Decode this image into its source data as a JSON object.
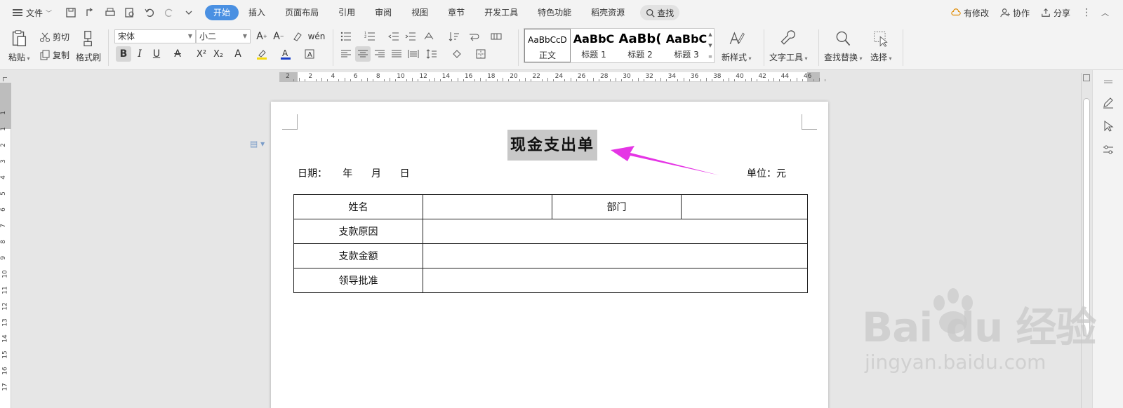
{
  "menu": {
    "file": "文件",
    "tabs": [
      "开始",
      "插入",
      "页面布局",
      "引用",
      "审阅",
      "视图",
      "章节",
      "开发工具",
      "特色功能",
      "稻壳资源"
    ],
    "active_tab": "开始",
    "search": "查找",
    "right": {
      "modified": "有修改",
      "collab": "协作",
      "share": "分享"
    }
  },
  "ribbon": {
    "paste": "粘贴",
    "cut": "剪切",
    "copy": "复制",
    "format_painter": "格式刷",
    "font_name": "宋体",
    "font_size": "小二",
    "styles": [
      {
        "preview": "AaBbCcD",
        "name": "正文"
      },
      {
        "preview": "AaBbC",
        "name": "标题 1"
      },
      {
        "preview": "AaBb(",
        "name": "标题 2"
      },
      {
        "preview": "AaBbC",
        "name": "标题 3"
      }
    ],
    "new_style": "新样式",
    "text_tools": "文字工具",
    "find_replace": "查找替换",
    "select": "选择",
    "accent_color": "#4a90e2"
  },
  "ruler": {
    "h_labels": [
      "2",
      "2",
      "4",
      "6",
      "8",
      "10",
      "12",
      "14",
      "16",
      "18",
      "20",
      "22",
      "24",
      "26",
      "28",
      "30",
      "32",
      "34",
      "36",
      "38",
      "40",
      "42",
      "44",
      "46"
    ],
    "v_labels": [
      "1",
      "1",
      "2",
      "3",
      "4",
      "5",
      "6",
      "7",
      "8",
      "9",
      "10",
      "11",
      "12",
      "13",
      "14",
      "15",
      "16",
      "17"
    ]
  },
  "document": {
    "title": "现金支出单",
    "date_line": "日期：     年      月      日",
    "unit": "单位：元",
    "table": [
      [
        "姓名",
        "",
        "部门",
        ""
      ],
      [
        "支款原因",
        ""
      ],
      [
        "支款金额",
        ""
      ],
      [
        "领导批准",
        ""
      ]
    ]
  },
  "annotation": {
    "arrow_color": "#e535e5"
  },
  "watermark": {
    "logo": "Bai du 经验",
    "url": "jingyan.baidu.com"
  }
}
